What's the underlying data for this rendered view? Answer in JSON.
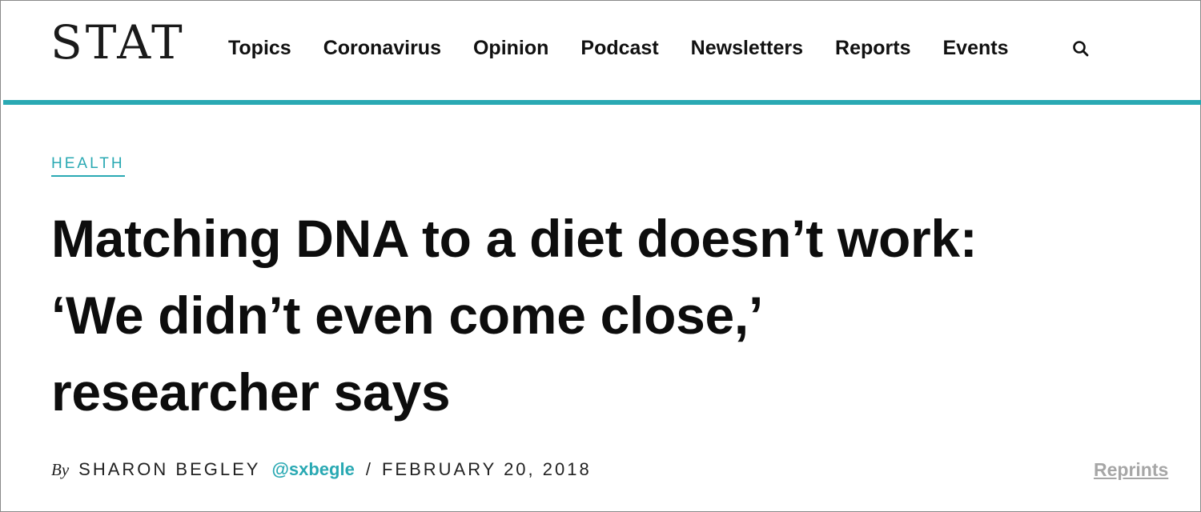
{
  "header": {
    "logo": "STAT",
    "nav": [
      "Topics",
      "Coronavirus",
      "Opinion",
      "Podcast",
      "Newsletters",
      "Reports",
      "Events"
    ],
    "search_icon": "search-icon"
  },
  "colors": {
    "accent": "#2aa9b3",
    "text": "#111111",
    "muted_link": "#a6a6a6"
  },
  "article": {
    "category": "HEALTH",
    "headline_lines": [
      "Matching DNA to a diet doesn’t work:",
      "‘We didn’t even come close,’",
      "researcher says"
    ],
    "byline": {
      "by": "By",
      "author": "SHARON BEGLEY",
      "handle": "@sxbegle",
      "separator": "/",
      "date": "FEBRUARY 20, 2018"
    },
    "reprints": "Reprints"
  }
}
